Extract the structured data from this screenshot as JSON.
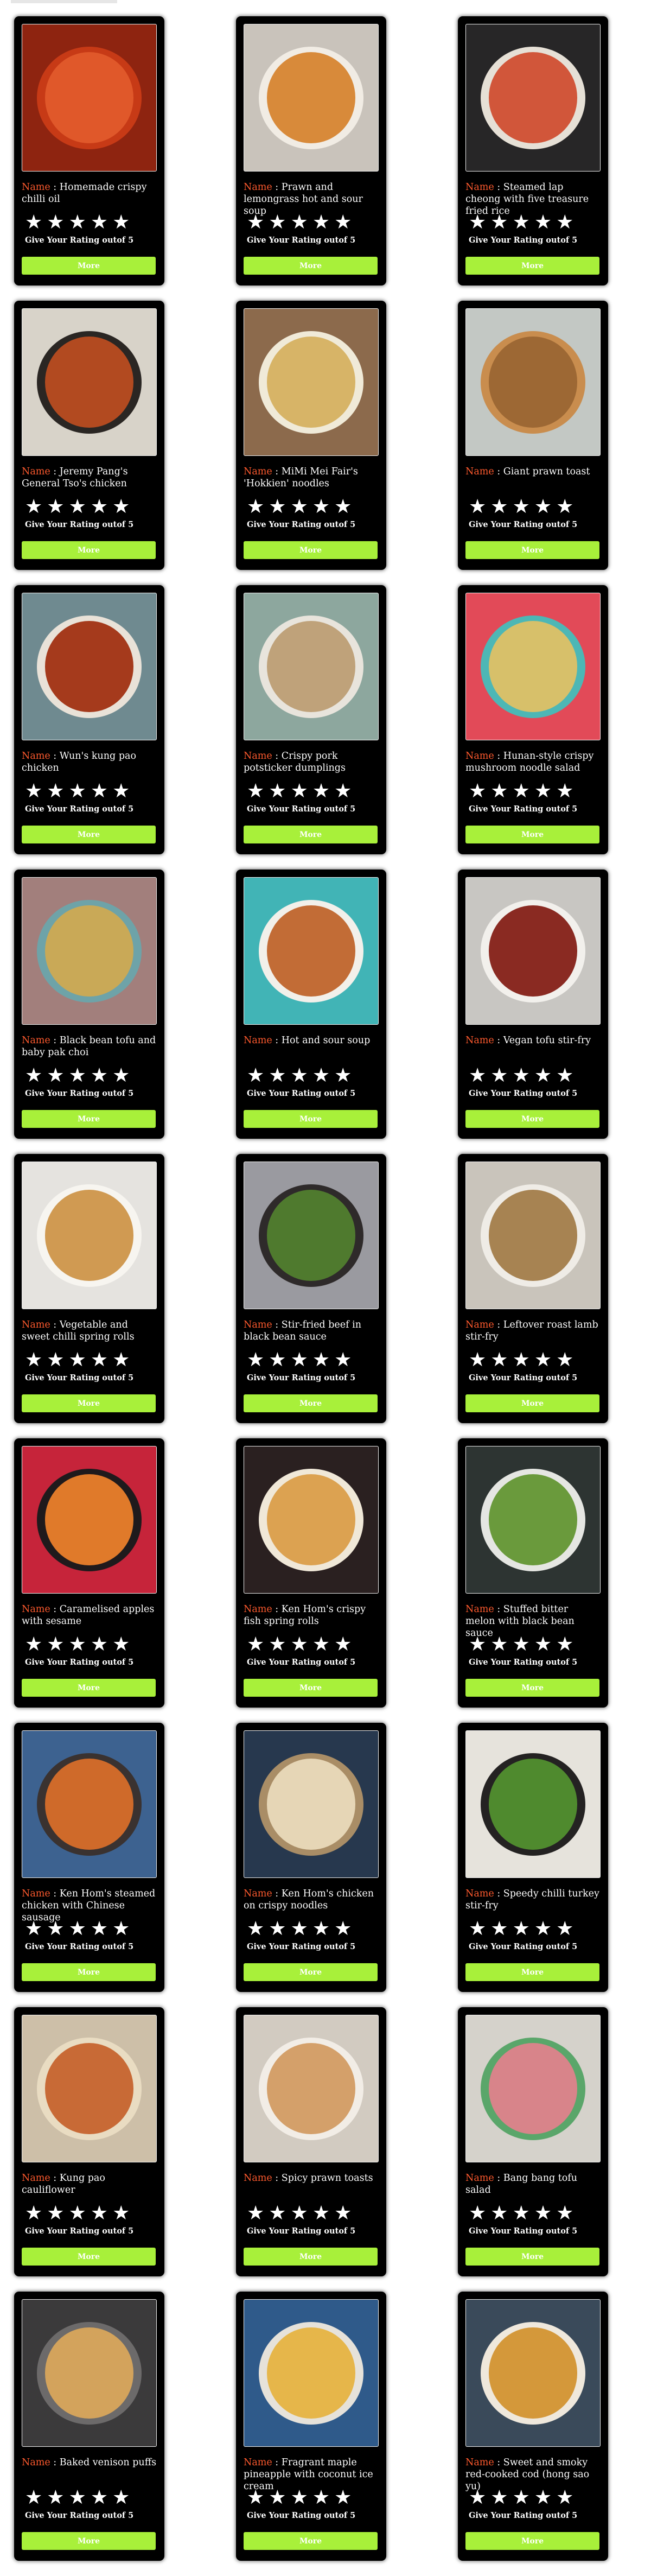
{
  "card_labels": {
    "name_key": "Name",
    "name_sep": " : ",
    "rating_text": "Give Your Rating outof 5",
    "more_label": "More",
    "star_glyph": "★"
  },
  "theme": {
    "card_bg": "#000000",
    "name_label_color": "#ff5a2e",
    "button_color": "#a8f03a",
    "text_color": "#ffffff"
  },
  "recipes": [
    {
      "name": "Homemade crispy chilli oil",
      "bg": "#8e2410",
      "dish": "#c73a16",
      "inner": "#e0582a"
    },
    {
      "name": "Prawn and lemongrass hot and sour soup",
      "bg": "#c9c3bb",
      "dish": "#f1ece4",
      "inner": "#d88a3a"
    },
    {
      "name": "Steamed lap cheong with five treasure fried rice",
      "bg": "#272627",
      "dish": "#e6e0d6",
      "inner": "#d1563a"
    },
    {
      "name": "Jeremy Pang's General Tso's chicken",
      "bg": "#d8d3c9",
      "dish": "#2a2623",
      "inner": "#b24a20"
    },
    {
      "name": "MiMi Mei Fair's 'Hokkien' noodles",
      "bg": "#8c6a4c",
      "dish": "#f0ead8",
      "inner": "#d7b467"
    },
    {
      "name": "Giant prawn toast",
      "bg": "#c3c8c4",
      "dish": "#c98d4e",
      "inner": "#9d6834"
    },
    {
      "name": "Wun's kung pao chicken",
      "bg": "#6f8a90",
      "dish": "#e9e2d8",
      "inner": "#a53a1c"
    },
    {
      "name": "Crispy pork potsticker dumplings",
      "bg": "#8da79e",
      "dish": "#e8e4dc",
      "inner": "#bfa27a"
    },
    {
      "name": "Hunan-style crispy mushroom noodle salad",
      "bg": "#e24a58",
      "dish": "#4db7b5",
      "inner": "#d7c06a"
    },
    {
      "name": "Black bean tofu and baby pak choi",
      "bg": "#a27f7c",
      "dish": "#6ea3a8",
      "inner": "#c9a957"
    },
    {
      "name": "Hot and sour soup",
      "bg": "#41b4b6",
      "dish": "#f2f0ea",
      "inner": "#c26c36"
    },
    {
      "name": "Vegan tofu stir-fry",
      "bg": "#c8c6c2",
      "dish": "#f2f0ec",
      "inner": "#8a2a22"
    },
    {
      "name": "Vegetable and sweet chilli spring rolls",
      "bg": "#e5e3df",
      "dish": "#f7f5f0",
      "inner": "#d09a52"
    },
    {
      "name": "Stir-fried beef in black bean sauce",
      "bg": "#9a9aa0",
      "dish": "#2e2a2a",
      "inner": "#4f7a2e"
    },
    {
      "name": "Leftover roast lamb stir-fry",
      "bg": "#c9c4bb",
      "dish": "#efece6",
      "inner": "#a78352"
    },
    {
      "name": "Caramelised apples with sesame",
      "bg": "#c6243a",
      "dish": "#1f1a1c",
      "inner": "#e07a2a"
    },
    {
      "name": "Ken Hom's crispy fish spring rolls",
      "bg": "#2a2020",
      "dish": "#f0e8d8",
      "inner": "#dca251"
    },
    {
      "name": "Stuffed bitter melon with black bean sauce",
      "bg": "#2d3432",
      "dish": "#e5e6e2",
      "inner": "#6a9a3c"
    },
    {
      "name": "Ken Hom's steamed chicken with Chinese sausage",
      "bg": "#3d6290",
      "dish": "#3a3230",
      "inner": "#cf6a2a"
    },
    {
      "name": "Ken Hom's chicken on crispy noodles",
      "bg": "#27384e",
      "dish": "#a98d66",
      "inner": "#e6d6b6"
    },
    {
      "name": "Speedy chilli turkey stir-fry",
      "bg": "#e6e3dc",
      "dish": "#242222",
      "inner": "#4f8a2e"
    },
    {
      "name": "Kung pao cauliflower",
      "bg": "#cdbfa8",
      "dish": "#e9dcc2",
      "inner": "#c86a36"
    },
    {
      "name": "Spicy prawn toasts",
      "bg": "#d2cbc1",
      "dish": "#f2ede6",
      "inner": "#d4a06a"
    },
    {
      "name": "Bang bang tofu salad",
      "bg": "#d5d2cb",
      "dish": "#5aa66a",
      "inner": "#d8848a"
    },
    {
      "name": "Baked venison puffs",
      "bg": "#3b3a3b",
      "dish": "#6c6a6a",
      "inner": "#d3a35c"
    },
    {
      "name": "Fragrant maple pineapple with coconut ice cream",
      "bg": "#2f5a8a",
      "dish": "#e6e2da",
      "inner": "#e6b64a"
    },
    {
      "name": "Sweet and smoky red-cooked cod (hong sao yu)",
      "bg": "#3a4a5a",
      "dish": "#efe8dc",
      "inner": "#d4983a"
    }
  ]
}
